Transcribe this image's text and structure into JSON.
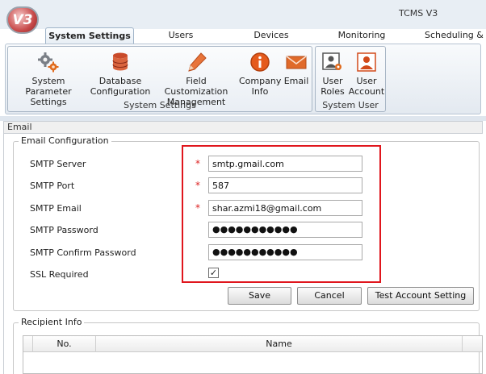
{
  "app": {
    "title": "TCMS V3",
    "logo_text": "V3"
  },
  "tabs": [
    {
      "label": "System Settings",
      "active": true
    },
    {
      "label": "Users"
    },
    {
      "label": "Devices"
    },
    {
      "label": "Monitoring"
    },
    {
      "label": "Scheduling &"
    }
  ],
  "ribbon": {
    "groups": [
      {
        "label": "System Settings",
        "buttons": [
          {
            "line1": "System Parameter",
            "line2": "Settings",
            "icon": "gears-icon"
          },
          {
            "line1": "Database",
            "line2": "Configuration",
            "icon": "database-icon"
          },
          {
            "line1": "Field Customization",
            "line2": "Management",
            "icon": "pencil-icon"
          },
          {
            "line1": "Company",
            "line2": "Info",
            "icon": "info-icon"
          },
          {
            "line1": "Email",
            "line2": "",
            "icon": "envelope-icon"
          }
        ]
      },
      {
        "label": "System User",
        "buttons": [
          {
            "line1": "User",
            "line2": "Roles",
            "icon": "user-roles-icon"
          },
          {
            "line1": "User",
            "line2": "Account",
            "icon": "user-account-icon"
          }
        ]
      }
    ]
  },
  "panel": {
    "title": "Email"
  },
  "email_config": {
    "title": "Email Configuration",
    "required_mark": "*",
    "fields": [
      {
        "label": "SMTP Server",
        "value": "smtp.gmail.com",
        "required": true
      },
      {
        "label": "SMTP Port",
        "value": "587",
        "required": true
      },
      {
        "label": "SMTP Email",
        "value": "shar.azmi18@gmail.com",
        "required": true
      },
      {
        "label": "SMTP Password",
        "value": "●●●●●●●●●●●",
        "required": false
      },
      {
        "label": "SMTP Confirm Password",
        "value": "●●●●●●●●●●●",
        "required": false
      }
    ],
    "ssl": {
      "label": "SSL Required",
      "checked": true,
      "mark": "✓"
    }
  },
  "buttons": {
    "save": "Save",
    "cancel": "Cancel",
    "test": "Test Account Setting"
  },
  "recipient": {
    "title": "Recipient Info",
    "columns": [
      "No.",
      "Name"
    ]
  },
  "colors": {
    "highlight": "#e0161d",
    "required": "#d22222"
  }
}
